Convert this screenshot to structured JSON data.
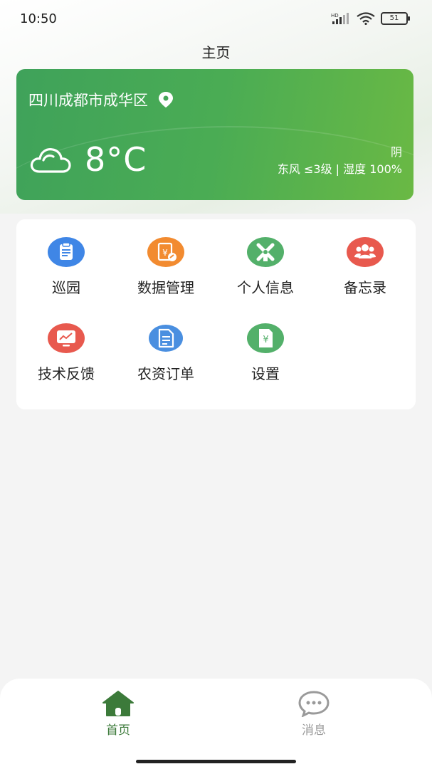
{
  "status_bar": {
    "time": "10:50",
    "battery": "51",
    "network_badge": "HD"
  },
  "header": {
    "title": "主页"
  },
  "weather": {
    "location": "四川成都市成华区",
    "temperature": "8°C",
    "condition": "阴",
    "wind_humidity": "东风 ≤3级 | 湿度 100%",
    "icon": "cloud-icon"
  },
  "menu": {
    "items": [
      {
        "label": "巡园",
        "icon": "clipboard-icon",
        "color": "#3f86e6"
      },
      {
        "label": "数据管理",
        "icon": "yuan-document-icon",
        "color": "#f28b30"
      },
      {
        "label": "个人信息",
        "icon": "windmill-icon",
        "color": "#53b06a"
      },
      {
        "label": "备忘录",
        "icon": "group-icon",
        "color": "#e8594e"
      },
      {
        "label": "技术反馈",
        "icon": "monitor-chart-icon",
        "color": "#e8594e"
      },
      {
        "label": "农资订单",
        "icon": "document-icon",
        "color": "#4a8fe0"
      },
      {
        "label": "设置",
        "icon": "yuan-file-icon",
        "color": "#53b06a"
      }
    ]
  },
  "bottom_nav": {
    "items": [
      {
        "label": "首页",
        "icon": "home-icon",
        "active": true,
        "color": "#3c7a3a"
      },
      {
        "label": "消息",
        "icon": "chat-icon",
        "active": false,
        "color": "#9a9a9a"
      }
    ]
  }
}
